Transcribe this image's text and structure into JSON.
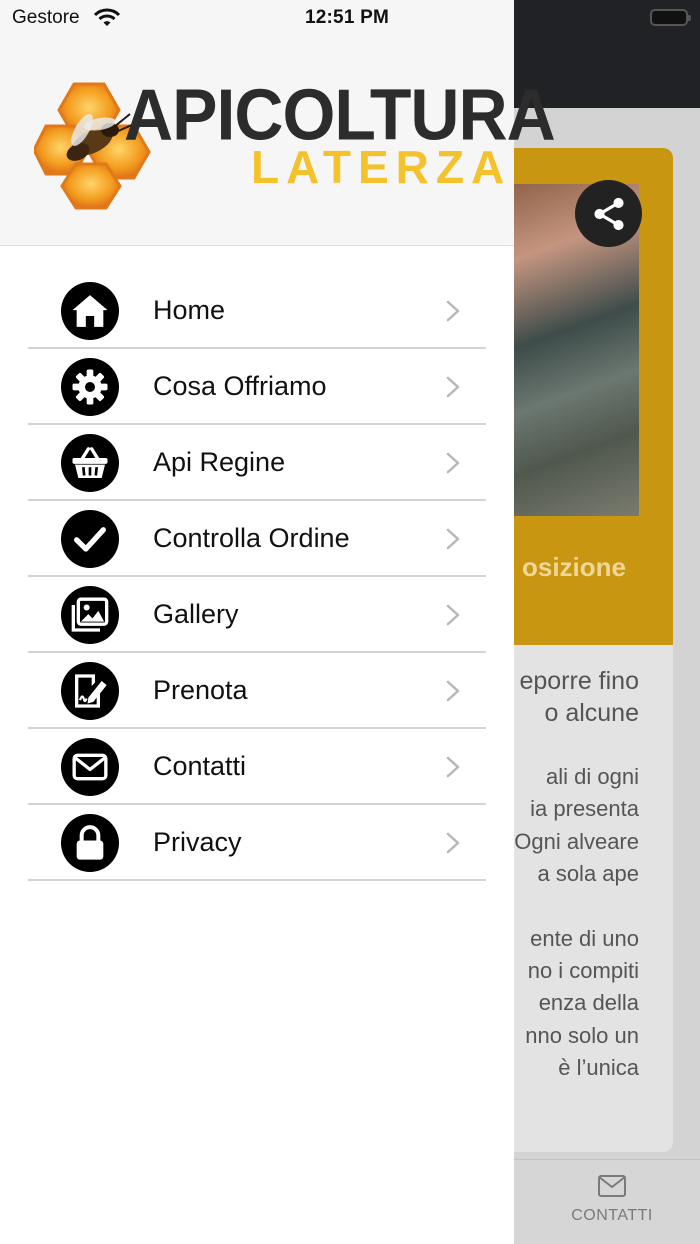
{
  "status_bar": {
    "carrier": "Gestore",
    "time": "12:51 PM"
  },
  "logo": {
    "title": "APICOLTURA",
    "subtitle": "LATERZA"
  },
  "menu": {
    "items": [
      {
        "label": "Home",
        "icon": "home-icon"
      },
      {
        "label": "Cosa Offriamo",
        "icon": "gear-icon"
      },
      {
        "label": "Api Regine",
        "icon": "basket-icon"
      },
      {
        "label": "Controlla Ordine",
        "icon": "checkmark-icon"
      },
      {
        "label": "Gallery",
        "icon": "gallery-icon"
      },
      {
        "label": "Prenota",
        "icon": "signature-document-icon"
      },
      {
        "label": "Contatti",
        "icon": "envelope-icon"
      },
      {
        "label": "Privacy",
        "icon": "lock-icon"
      }
    ]
  },
  "background": {
    "card_title_fragment": "osizione",
    "lead_lines": [
      "eporre fino",
      "o   alcune"
    ],
    "para1_lines": [
      "ali di ogni",
      "ia presenta",
      "Ogni alveare",
      "a sola ape"
    ],
    "para2_lines": [
      "ente di uno",
      "no i compiti",
      "enza   della",
      "nno solo un",
      "è   l’unica"
    ],
    "tab_label": "CONTATTI"
  },
  "colors": {
    "accent": "#c89610",
    "logo_yellow": "#f3c22c",
    "drawer_header_bg": "#f6f6f6",
    "icon_circle": "#000000",
    "chevron": "#b8b8b8"
  }
}
